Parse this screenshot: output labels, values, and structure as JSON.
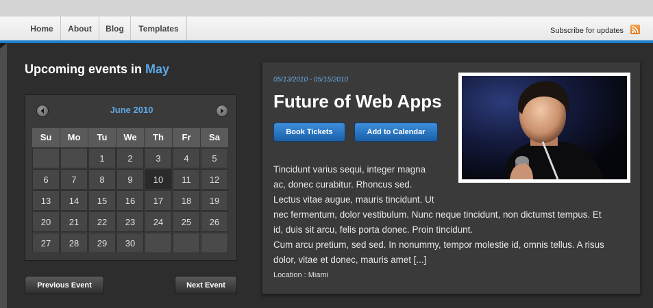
{
  "nav": {
    "links": [
      "Home",
      "About",
      "Blog",
      "Templates"
    ],
    "subscribe": "Subscribe for updates"
  },
  "heading": {
    "prefix": "Upcoming events in ",
    "month": "May"
  },
  "calendar": {
    "title": "June 2010",
    "days_of_week": [
      "Su",
      "Mo",
      "Tu",
      "We",
      "Th",
      "Fr",
      "Sa"
    ],
    "weeks": [
      [
        "",
        "",
        "1",
        "2",
        "3",
        "4",
        "5"
      ],
      [
        "6",
        "7",
        "8",
        "9",
        "10",
        "11",
        "12"
      ],
      [
        "13",
        "14",
        "15",
        "16",
        "17",
        "18",
        "19"
      ],
      [
        "20",
        "21",
        "22",
        "23",
        "24",
        "25",
        "26"
      ],
      [
        "27",
        "28",
        "29",
        "30",
        "",
        "",
        ""
      ]
    ],
    "highlighted_day": "10"
  },
  "buttons": {
    "previous": "Previous Event",
    "next": "Next Event"
  },
  "event": {
    "date": "05/13/2010 - 05/15/2010",
    "title": "Future of Web Apps",
    "book": "Book Tickets",
    "add_calendar": "Add to Calendar",
    "description_lines": [
      "Tincidunt varius sequi, integer magna",
      "ac, donec curabitur. Rhoncus sed.",
      "Lectus vitae augue, mauris tincidunt. Ut",
      "nec fermentum, dolor vestibulum. Nunc neque tincidunt, non dictumst tempus. Et",
      "id, duis sit arcu, felis porta donec. Proin tincidunt.",
      "Cum arcu pretium, sed sed. In nonummy, tempor molestie id, omnis tellus. A risus",
      "dolor, vitae et donec, mauris amet [...]"
    ],
    "location": "Location : Miami"
  },
  "colors": {
    "accent_blue": "#1e7fd1",
    "heading_month": "#5ea8e6",
    "button_blue": "#2a76c4",
    "rss_orange": "#ef8a2e"
  },
  "icons": {
    "rss": "rss-feed-icon",
    "prev_month": "chevron-left-icon",
    "next_month": "chevron-right-icon"
  }
}
